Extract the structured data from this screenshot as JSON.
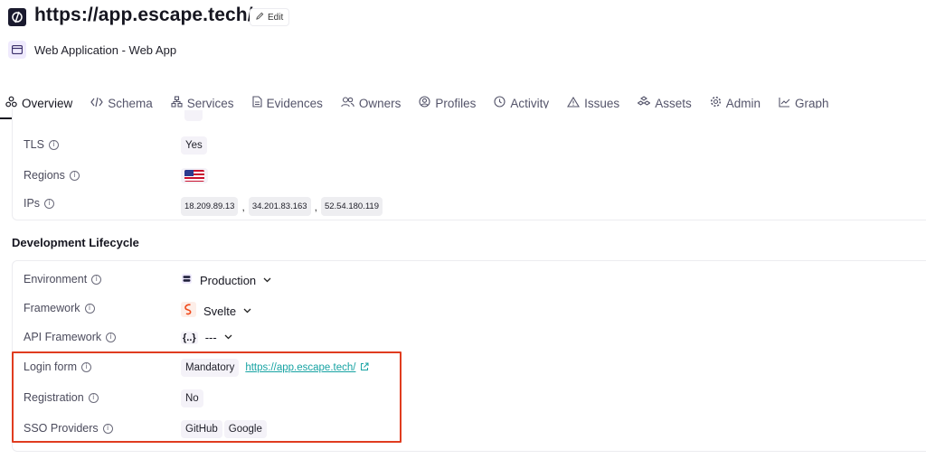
{
  "header": {
    "title": "https://app.escape.tech/",
    "edit_label": "Edit",
    "subtitle": "Web Application - Web App"
  },
  "tabs": [
    {
      "label": "Overview",
      "icon": "overview-icon",
      "active": true
    },
    {
      "label": "Schema",
      "icon": "code-icon"
    },
    {
      "label": "Services",
      "icon": "services-icon"
    },
    {
      "label": "Evidences",
      "icon": "document-icon"
    },
    {
      "label": "Owners",
      "icon": "users-icon"
    },
    {
      "label": "Profiles",
      "icon": "profile-icon"
    },
    {
      "label": "Activity",
      "icon": "clock-icon"
    },
    {
      "label": "Issues",
      "icon": "warning-icon"
    },
    {
      "label": "Assets",
      "icon": "assets-icon"
    },
    {
      "label": "Admin",
      "icon": "gear-icon"
    },
    {
      "label": "Graph",
      "icon": "chart-icon"
    }
  ],
  "network": {
    "tls_label": "TLS",
    "tls_value": "Yes",
    "regions_label": "Regions",
    "regions_value": "us-flag-icon",
    "ips_label": "IPs",
    "ips": [
      "18.209.89.13",
      "34.201.83.163",
      "52.54.180.119"
    ],
    "ip_separator": ","
  },
  "lifecycle": {
    "section_title": "Development Lifecycle",
    "environment_label": "Environment",
    "environment_value": "Production",
    "framework_label": "Framework",
    "framework_value": "Svelte",
    "api_framework_label": "API Framework",
    "api_framework_icon_text": "{..}",
    "api_framework_value": "---",
    "login_form_label": "Login form",
    "login_form_value": "Mandatory",
    "login_form_link": "https://app.escape.tech/",
    "registration_label": "Registration",
    "registration_value": "No",
    "sso_label": "SSO Providers",
    "sso_providers": [
      "GitHub",
      "Google"
    ]
  },
  "colors": {
    "highlight": "#e03c1f",
    "link": "#17a3a3",
    "accent": "#161620"
  }
}
